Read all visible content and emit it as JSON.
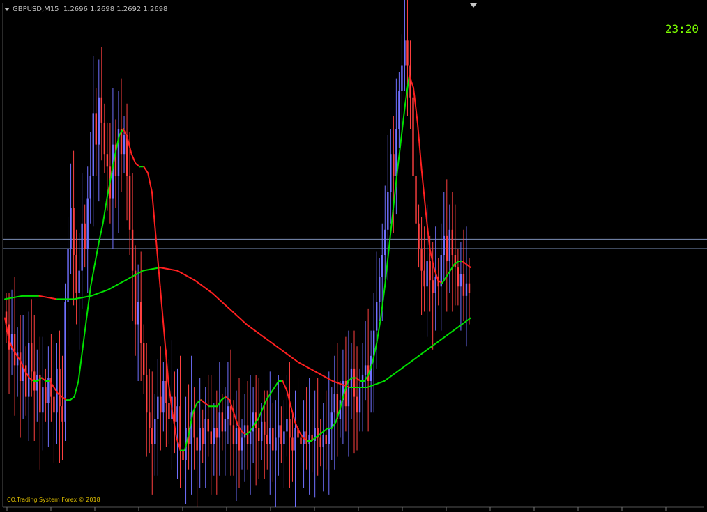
{
  "header": {
    "symbol": "GBPUSD,M15",
    "ohlc": "1.2696 1.2698 1.2692 1.2698"
  },
  "clock": "23:20",
  "copyright": "CO.Trading System Forex © 2018",
  "colors": {
    "background": "#000000",
    "bull": "#7070ff",
    "bear": "#ff4040",
    "ma_up": "#00e000",
    "ma_down": "#ff2020",
    "hline": "#7d8fb8",
    "clock": "#7cfc00",
    "copyright": "#e0c000"
  },
  "chart_data": {
    "type": "candlestick",
    "title": "",
    "ylim": [
      1.263,
      1.279
    ],
    "horizontal_lines": [
      1.2715,
      1.2712
    ],
    "candle_closes": [
      1.2688,
      1.268,
      1.2685,
      1.2675,
      1.2679,
      1.267,
      1.2675,
      1.2665,
      1.2682,
      1.2673,
      1.2667,
      1.2672,
      1.266,
      1.2668,
      1.2663,
      1.2671,
      1.2665,
      1.266,
      1.2674,
      1.2662,
      1.2657,
      1.2695,
      1.2712,
      1.2725,
      1.271,
      1.2698,
      1.2705,
      1.272,
      1.2712,
      1.2728,
      1.2735,
      1.2755,
      1.2745,
      1.276,
      1.2752,
      1.2742,
      1.2738,
      1.2728,
      1.2745,
      1.2735,
      1.275,
      1.2742,
      1.2748,
      1.2735,
      1.2718,
      1.2705,
      1.2688,
      1.2695,
      1.2682,
      1.2672,
      1.266,
      1.2655,
      1.265,
      1.2658,
      1.2665,
      1.266,
      1.267,
      1.2663,
      1.2658,
      1.2665,
      1.2657,
      1.2662,
      1.2648,
      1.2645,
      1.2655,
      1.265,
      1.266,
      1.2652,
      1.2648,
      1.2655,
      1.265,
      1.2658,
      1.2654,
      1.265,
      1.2655,
      1.2652,
      1.266,
      1.2654,
      1.2658,
      1.2662,
      1.2656,
      1.265,
      1.2655,
      1.2648,
      1.2652,
      1.2656,
      1.265,
      1.2654,
      1.266,
      1.2655,
      1.2651,
      1.2657,
      1.2653,
      1.265,
      1.2655,
      1.2648,
      1.2652,
      1.2656,
      1.265,
      1.2654,
      1.2658,
      1.2652,
      1.2648,
      1.2655,
      1.2652,
      1.265,
      1.2654,
      1.265,
      1.2653,
      1.2651,
      1.2655,
      1.2652,
      1.2649,
      1.2653,
      1.265,
      1.2655,
      1.266,
      1.2666,
      1.2658,
      1.2664,
      1.267,
      1.2662,
      1.2668,
      1.2674,
      1.2665,
      1.266,
      1.2668,
      1.2672,
      1.2675,
      1.267,
      1.2678,
      1.2686,
      1.2695,
      1.2703,
      1.271,
      1.2718,
      1.273,
      1.2742,
      1.2735,
      1.275,
      1.2762,
      1.277,
      1.2778,
      1.277,
      1.276,
      1.2735,
      1.272,
      1.2712,
      1.2705,
      1.27,
      1.2708,
      1.2702,
      1.2698,
      1.2703,
      1.27,
      1.271,
      1.2716,
      1.2708,
      1.2718,
      1.271,
      1.2706,
      1.27,
      1.2704,
      1.2697,
      1.2701,
      1.2698
    ],
    "ma_fast": [
      1.269,
      1.2683,
      1.268,
      1.2678,
      1.2676,
      1.2673,
      1.2671,
      1.267,
      1.267,
      1.2671,
      1.267,
      1.267,
      1.2668,
      1.2666,
      1.2665,
      1.2664,
      1.2664,
      1.2665,
      1.267,
      1.268,
      1.269,
      1.27,
      1.2707,
      1.2714,
      1.272,
      1.2728,
      1.2735,
      1.2742,
      1.2748,
      1.275,
      1.2747,
      1.2742,
      1.2739,
      1.2738,
      1.2738,
      1.2736,
      1.273,
      1.2715,
      1.27,
      1.2685,
      1.267,
      1.266,
      1.2652,
      1.2648,
      1.2648,
      1.2653,
      1.266,
      1.2663,
      1.2664,
      1.2663,
      1.2662,
      1.2662,
      1.2662,
      1.2664,
      1.2665,
      1.2664,
      1.266,
      1.2656,
      1.2654,
      1.2653,
      1.2654,
      1.2656,
      1.2658,
      1.2661,
      1.2664,
      1.2666,
      1.2668,
      1.267,
      1.267,
      1.2667,
      1.2662,
      1.2657,
      1.2654,
      1.2652,
      1.2651,
      1.2651,
      1.2652,
      1.2653,
      1.2654,
      1.2655,
      1.2655,
      1.2657,
      1.2661,
      1.2666,
      1.267,
      1.2671,
      1.2671,
      1.267,
      1.267,
      1.2672,
      1.2676,
      1.2682,
      1.269,
      1.27,
      1.2712,
      1.2724,
      1.2736,
      1.2747,
      1.2758,
      1.2767,
      1.2763,
      1.2752,
      1.2737,
      1.2724,
      1.2712,
      1.2706,
      1.2702,
      1.2701,
      1.2703,
      1.2705,
      1.2707,
      1.2708,
      1.2708,
      1.2707,
      1.2706
    ],
    "ma_slow": [
      1.2696,
      1.2697,
      1.2697,
      1.2696,
      1.2696,
      1.2697,
      1.2699,
      1.2702,
      1.2705,
      1.2706,
      1.2705,
      1.2702,
      1.2698,
      1.2693,
      1.2688,
      1.2684,
      1.268,
      1.2676,
      1.2673,
      1.267,
      1.2668,
      1.2668,
      1.267,
      1.2674,
      1.2678,
      1.2682,
      1.2686,
      1.269
    ]
  }
}
